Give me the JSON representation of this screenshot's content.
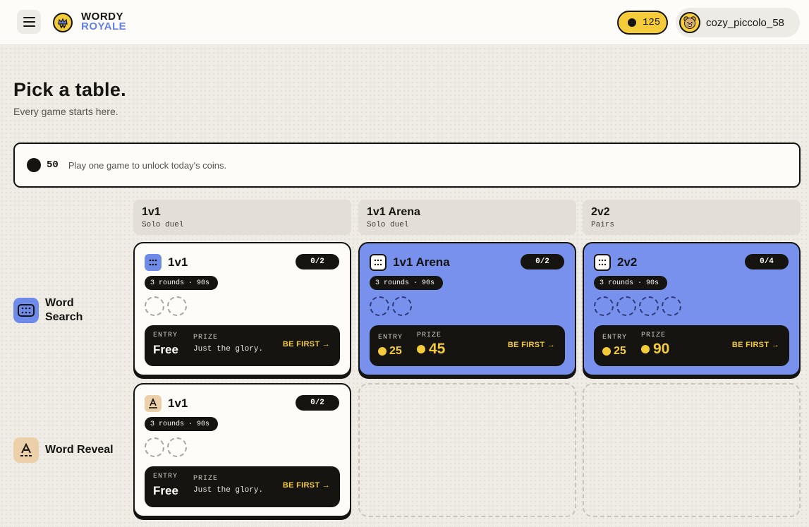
{
  "header": {
    "logo_line1": "WORDY",
    "logo_line2": "ROYALE",
    "coins": "125",
    "username": "cozy_piccolo_58"
  },
  "page": {
    "title": "Pick a table.",
    "subtitle": "Every game starts here."
  },
  "banner": {
    "amount": "50",
    "message": "Play one game to unlock today's coins."
  },
  "columns": [
    {
      "title": "1v1",
      "subtitle": "Solo duel"
    },
    {
      "title": "1v1 Arena",
      "subtitle": "Solo duel"
    },
    {
      "title": "2v2",
      "subtitle": "Pairs"
    }
  ],
  "rows": [
    {
      "label": "Word Search",
      "icon": "grid-icon"
    },
    {
      "label": "Word Reveal",
      "icon": "letter-a-icon"
    }
  ],
  "cards": {
    "ws_1v1": {
      "title": "1v1",
      "seats": "0/2",
      "rounds": "3 rounds · 90s",
      "entry_label": "ENTRY",
      "prize_label": "PRIZE",
      "entry_value": "Free",
      "prize_value": "Just the glory.",
      "cta": "BE FIRST →"
    },
    "ws_arena": {
      "title": "1v1 Arena",
      "seats": "0/2",
      "rounds": "3 rounds · 90s",
      "entry_label": "ENTRY",
      "prize_label": "PRIZE",
      "entry_value": "25",
      "prize_value": "45",
      "cta": "BE FIRST →"
    },
    "ws_2v2": {
      "title": "2v2",
      "seats": "0/4",
      "rounds": "3 rounds · 90s",
      "entry_label": "ENTRY",
      "prize_label": "PRIZE",
      "entry_value": "25",
      "prize_value": "90",
      "cta": "BE FIRST →"
    },
    "wr_1v1": {
      "title": "1v1",
      "seats": "0/2",
      "rounds": "3 rounds · 90s",
      "entry_label": "ENTRY",
      "prize_label": "PRIZE",
      "entry_value": "Free",
      "prize_value": "Just the glory.",
      "cta": "BE FIRST →"
    }
  },
  "colors": {
    "accent_blue": "#7891ec",
    "coin_yellow": "#f4cb39",
    "ink": "#151410"
  }
}
